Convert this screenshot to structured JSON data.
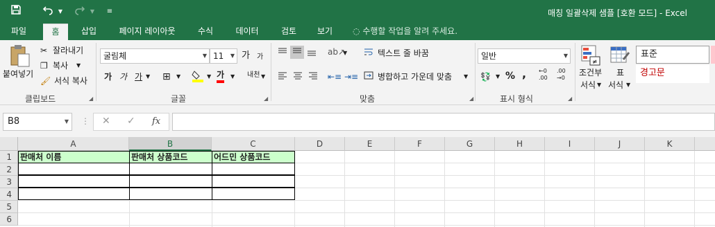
{
  "window": {
    "title": "매칭 일괄삭제 샘플  [호환 모드] - Excel"
  },
  "qat": {
    "save": "save-icon",
    "undo": "undo-icon",
    "redo": "redo-icon",
    "customize": "customize-icon"
  },
  "tabs": [
    "파일",
    "홈",
    "삽입",
    "페이지 레이아웃",
    "수식",
    "데이터",
    "검토",
    "보기"
  ],
  "tell_me": "수행할 작업을 알려 주세요.",
  "clipboard": {
    "paste": "붙여넣기",
    "cut": "잘라내기",
    "copy": "복사",
    "format_painter": "서식 복사",
    "label": "클립보드"
  },
  "font": {
    "name": "굴림체",
    "size": "11",
    "grow": "가",
    "shrink": "가",
    "bold": "가",
    "italic": "가",
    "underline": "가",
    "font_color_glyph": "가",
    "phonetic": "내천",
    "label": "글꼴"
  },
  "alignment": {
    "wrap": "텍스트 줄 바꿈",
    "merge": "병합하고 가운데 맞춤",
    "label": "맞춤"
  },
  "number": {
    "format": "일반",
    "percent": "%",
    "comma": ",",
    "inc_decimal": "←0 .00",
    "dec_decimal": ".00 →0",
    "label": "표시 형식"
  },
  "styles": {
    "conditional": [
      "조건부",
      "서식"
    ],
    "table": [
      "표",
      "서식"
    ],
    "normal": "표준",
    "bad": "경고문"
  },
  "formula_bar": {
    "name_box": "B8",
    "cancel": "✕",
    "enter": "✓",
    "fx": "fx",
    "value": ""
  },
  "sheet": {
    "columns": [
      "A",
      "B",
      "C",
      "D",
      "E",
      "F",
      "G",
      "H",
      "I",
      "J",
      "K"
    ],
    "selected_column": "B",
    "rows": [
      "1",
      "2",
      "3",
      "4",
      "5",
      "6"
    ],
    "headers": [
      "판매처 이름",
      "판매처 상품코드",
      "어드민 상품코드"
    ],
    "colors": {
      "header_fill": "#ccffcc",
      "accent": "#217346"
    }
  }
}
